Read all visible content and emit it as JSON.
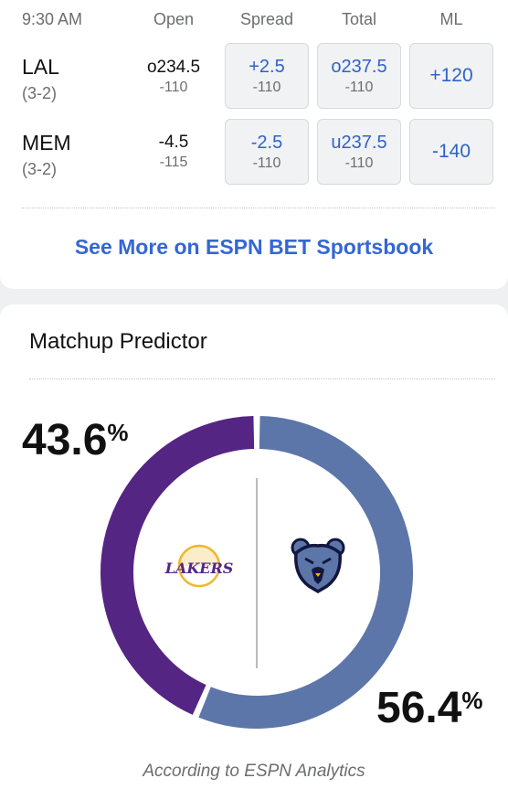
{
  "odds": {
    "headers": {
      "time": "9:30 AM",
      "open": "Open",
      "spread": "Spread",
      "total": "Total",
      "ml": "ML"
    },
    "rows": [
      {
        "team": "LAL",
        "record": "(3-2)",
        "open_main": "o234.5",
        "open_sub": "-110",
        "spread_main": "+2.5",
        "spread_sub": "-110",
        "total_main": "o237.5",
        "total_sub": "-110",
        "ml": "+120"
      },
      {
        "team": "MEM",
        "record": "(3-2)",
        "open_main": "-4.5",
        "open_sub": "-115",
        "spread_main": "-2.5",
        "spread_sub": "-110",
        "total_main": "u237.5",
        "total_sub": "-110",
        "ml": "-140"
      }
    ],
    "see_more": "See More on ESPN BET Sportsbook"
  },
  "predictor": {
    "title": "Matchup Predictor",
    "away": {
      "team": "LAL",
      "pct_value": "43.6",
      "pct_sign": "%",
      "color": "#552583",
      "logo": "lakers-logo"
    },
    "home": {
      "team": "MEM",
      "pct_value": "56.4",
      "pct_sign": "%",
      "color": "#5d76a9",
      "logo": "grizzlies-logo"
    },
    "footnote": "According to ESPN Analytics"
  },
  "colors": {
    "link_blue": "#3467d3",
    "odds_blue": "#2f62c9",
    "muted": "#6c6d6f"
  }
}
